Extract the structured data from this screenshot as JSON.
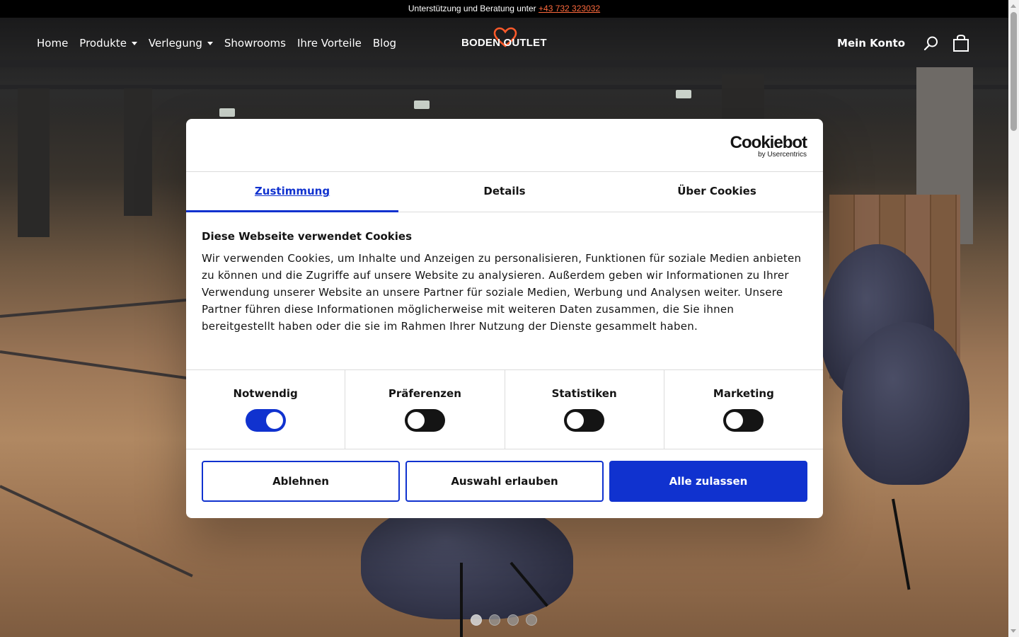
{
  "topbar": {
    "text": "Unterstützung und Beratung unter",
    "phone": "+43 732 323032"
  },
  "nav": {
    "items": [
      {
        "label": "Home"
      },
      {
        "label": "Produkte",
        "dropdown": true
      },
      {
        "label": "Verlegung",
        "dropdown": true
      },
      {
        "label": "Showrooms"
      },
      {
        "label": "Ihre Vorteile"
      },
      {
        "label": "Blog"
      }
    ],
    "logo_text": "BODEN OUTLET",
    "account_label": "Mein Konto",
    "icons": [
      "search-icon",
      "shopping-bag-icon"
    ]
  },
  "carousel": {
    "slide_count": 4,
    "active_index": 0
  },
  "cookie_dialog": {
    "brand": "Cookiebot",
    "brand_sub": "by Usercentrics",
    "tabs": [
      {
        "label": "Zustimmung",
        "active": true
      },
      {
        "label": "Details",
        "active": false
      },
      {
        "label": "Über Cookies",
        "active": false
      }
    ],
    "heading": "Diese Webseite verwendet Cookies",
    "body": "Wir verwenden Cookies, um Inhalte und Anzeigen zu personalisieren, Funktionen für soziale Medien anbieten zu können und die Zugriffe auf unsere Website zu analysieren. Außerdem geben wir Informationen zu Ihrer Verwendung unserer Website an unsere Partner für soziale Medien, Werbung und Analysen weiter. Unsere Partner führen diese Informationen möglicherweise mit weiteren Daten zusammen, die Sie ihnen bereitgestellt haben oder die sie im Rahmen Ihrer Nutzung der Dienste gesammelt haben.",
    "toggles": [
      {
        "label": "Notwendig",
        "checked": true
      },
      {
        "label": "Präferenzen",
        "checked": false
      },
      {
        "label": "Statistiken",
        "checked": false
      },
      {
        "label": "Marketing",
        "checked": false
      }
    ],
    "buttons": {
      "decline": "Ablehnen",
      "allow_selection": "Auswahl erlauben",
      "allow_all": "Alle zulassen"
    }
  },
  "colors": {
    "accent_blue": "#1032cf",
    "topbar_link": "#ff6a3d",
    "logo_heart": "#ff5a2a"
  }
}
